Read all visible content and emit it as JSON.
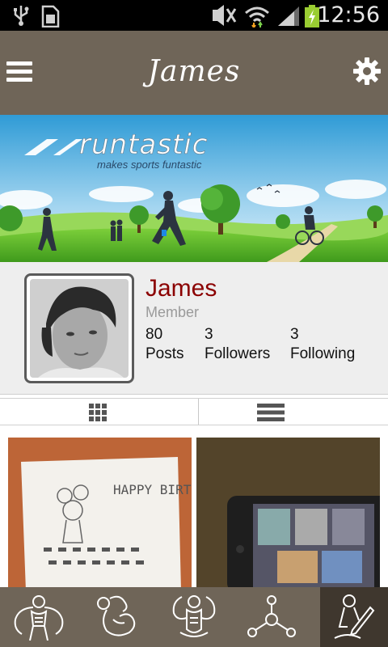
{
  "status_bar": {
    "time": "12:56",
    "icons": [
      "usb-icon",
      "sim-card-icon",
      "nfc-muted-icon",
      "wifi-icon",
      "signal-icon",
      "battery-charging-icon"
    ]
  },
  "action_bar": {
    "title": "James",
    "menu_icon": "hamburger-menu-icon",
    "settings_icon": "gear-icon"
  },
  "banner": {
    "brand": "runtastic",
    "tagline": "makes sports funtastic"
  },
  "profile": {
    "name": "James",
    "role": "Member",
    "stats": [
      {
        "value": "80",
        "label": "Posts"
      },
      {
        "value": "3",
        "label": "Followers"
      },
      {
        "value": "3",
        "label": "Following"
      }
    ]
  },
  "view_toggle": {
    "grid_icon": "grid-view-icon",
    "list_icon": "list-view-icon"
  },
  "posts": [
    {
      "kind": "photo",
      "caption_art": "HAPPY BIRTHDAY"
    },
    {
      "kind": "photo",
      "caption_art": ""
    }
  ],
  "bottom_nav": {
    "tabs": [
      {
        "icon": "bodybuilder-front-icon",
        "active": false
      },
      {
        "icon": "flexing-arm-icon",
        "active": false
      },
      {
        "icon": "muscle-torso-icon",
        "active": false
      },
      {
        "icon": "social-network-icon",
        "active": false
      },
      {
        "icon": "edit-pen-icon",
        "active": true
      }
    ]
  },
  "colors": {
    "bar_brown": "#6f6558",
    "active_tab": "#3f372e",
    "name_red": "#8b0000"
  }
}
